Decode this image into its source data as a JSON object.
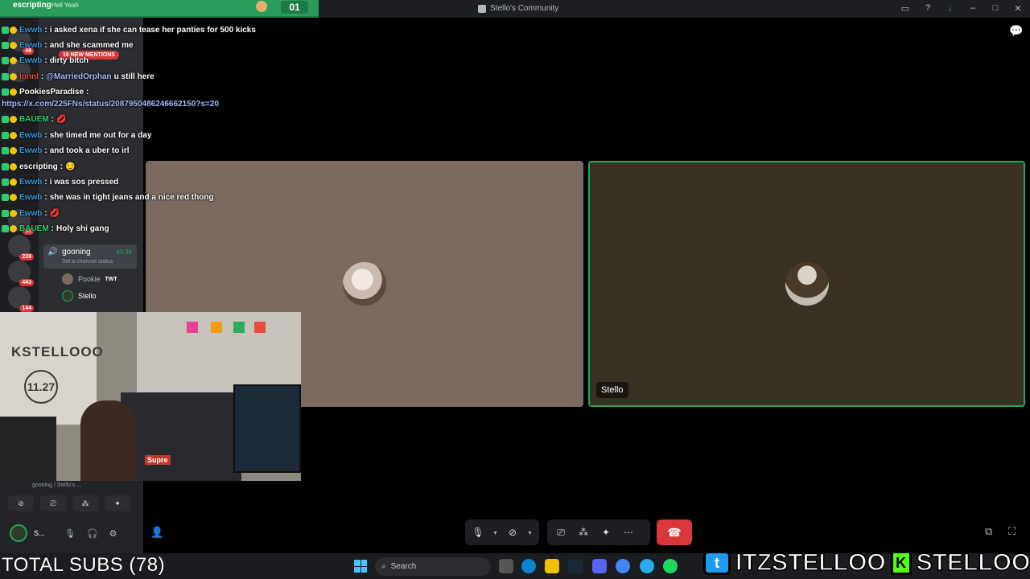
{
  "window": {
    "title": "Stello's Community"
  },
  "alert": {
    "user": "escripting",
    "message": "Hell Yeah",
    "count": "01"
  },
  "chat": {
    "mentions_pill": "16 NEW MENTIONS",
    "messages": [
      {
        "user": "Ewwb",
        "user_color": "#3498db",
        "sep": " : ",
        "text": "i asked xena if she can tease her panties for 500 kicks"
      },
      {
        "user": "Ewwb",
        "user_color": "#3498db",
        "sep": " : ",
        "text": "and she scammed me"
      },
      {
        "user": "Ewwb",
        "user_color": "#3498db",
        "sep": " : ",
        "text": "dirty bitch"
      },
      {
        "user": "lonnl",
        "user_color": "#e74c3c",
        "sep": " : ",
        "mention": "@MarriedOrphan",
        "text": " u still here"
      },
      {
        "user": "PookiesParadise",
        "user_color": "#ffffff",
        "sep": " :",
        "text": ""
      },
      {
        "link": "https://x.com/225FNs/status/2087950486246662150?s=20"
      },
      {
        "user": "BAUEM",
        "user_color": "#2ecc71",
        "sep": " : ",
        "text": "💋"
      },
      {
        "user": "Ewwb",
        "user_color": "#3498db",
        "sep": " : ",
        "text": "she timed me out for a day"
      },
      {
        "user": "Ewwb",
        "user_color": "#3498db",
        "sep": " : ",
        "text": "and took a uber to irl"
      },
      {
        "user": "escripting",
        "user_color": "#ffffff",
        "sep": " : ",
        "text": "😏"
      },
      {
        "user": "Ewwb",
        "user_color": "#3498db",
        "sep": " : ",
        "text": "i was sos pressed"
      },
      {
        "user": "Ewwb",
        "user_color": "#3498db",
        "sep": " : ",
        "text": "she was in tight jeans and a nice red thong"
      },
      {
        "user": "Ewwb",
        "user_color": "#3498db",
        "sep": " : ",
        "text": "💋"
      },
      {
        "user": "BAUEM",
        "user_color": "#2ecc71",
        "sep": " : ",
        "text": "Holy shi gang"
      }
    ]
  },
  "sidebar": {
    "servers": [
      {
        "badge": "48"
      },
      {
        "badge": ""
      },
      {
        "badge": "16"
      },
      {
        "badge": "228"
      },
      {
        "badge": "443"
      },
      {
        "badge": "144"
      }
    ],
    "voice_channel": {
      "name": "gooning",
      "time": "40:38",
      "status": "Set a channel status"
    },
    "members": [
      {
        "name": "Pookie",
        "tag": "TWT"
      },
      {
        "name": "Stello",
        "tag": ""
      }
    ],
    "voice_connected": "gooning / Stello's ...",
    "user": {
      "name": "S..."
    }
  },
  "call": {
    "tiles": [
      {
        "name": "Pookie",
        "show_tag": false
      },
      {
        "name": "Stello",
        "show_tag": true
      }
    ]
  },
  "overlay": {
    "subs": "TOTAL SUBS (78)",
    "twitter_handle": "ITZSTELLOO",
    "kick_handle": "STELLOOO"
  },
  "webcam": {
    "box_text": "KSTELLOOO",
    "box_number": "11.27",
    "supreme": "Supre"
  },
  "taskbar": {
    "search_placeholder": "Search"
  },
  "colors": {
    "accent_green": "#23a55a",
    "hangup_red": "#da373c",
    "alert_green": "#2a9d5c"
  }
}
